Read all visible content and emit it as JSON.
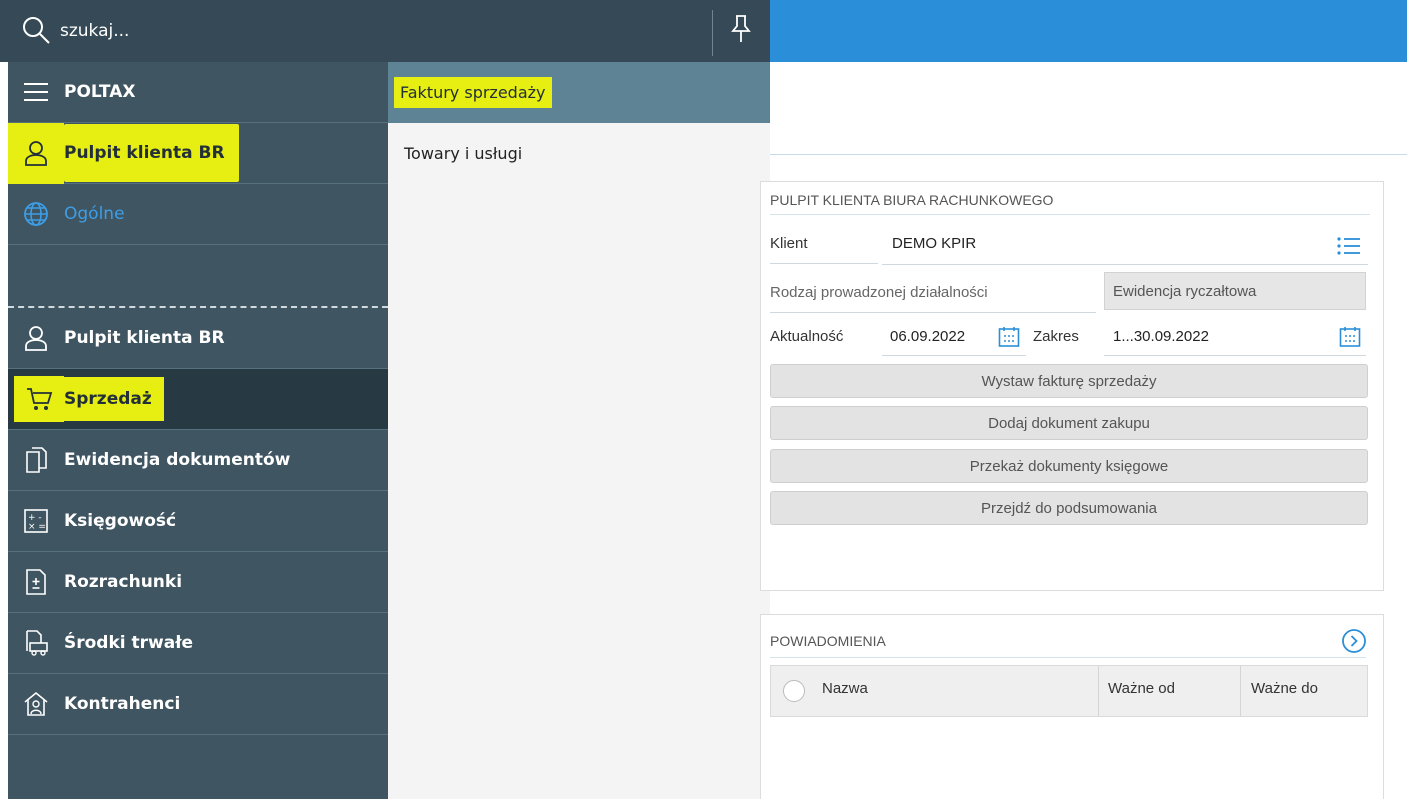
{
  "search": {
    "placeholder": "szukaj..."
  },
  "nav": {
    "items": [
      {
        "label": "POLTAX",
        "icon": "menu-icon"
      },
      {
        "label": "Pulpit klienta BR",
        "icon": "user-icon",
        "highlighted": true
      },
      {
        "label": "Ogólne",
        "icon": "globe-icon"
      },
      {
        "label": "Pulpit klienta BR",
        "icon": "user-icon"
      },
      {
        "label": "Sprzedaż",
        "icon": "cart-icon",
        "active": true,
        "highlighted": true
      },
      {
        "label": "Ewidencja dokumentów",
        "icon": "documents-icon"
      },
      {
        "label": "Księgowość",
        "icon": "calculator-icon"
      },
      {
        "label": "Rozrachunki",
        "icon": "settlement-icon"
      },
      {
        "label": "Środki trwałe",
        "icon": "assets-icon"
      },
      {
        "label": "Kontrahenci",
        "icon": "contractors-icon"
      }
    ]
  },
  "flyout": {
    "header": "Faktury sprzedaży",
    "items": [
      "Towary i usługi"
    ]
  },
  "dashboard": {
    "title": "PULPIT KLIENTA BIURA RACHUNKOWEGO",
    "client_label": "Klient",
    "client_value": "DEMO KPIR",
    "activity_label": "Rodzaj prowadzonej działalności",
    "activity_value": "Ewidencja ryczałtowa",
    "date_label": "Aktualność",
    "date_value": "06.09.2022",
    "range_label": "Zakres",
    "range_value": "1...30.09.2022",
    "buttons": [
      "Wystaw fakturę sprzedaży",
      "Dodaj dokument zakupu",
      "Przekaż dokumenty księgowe",
      "Przejdź do podsumowania"
    ]
  },
  "notifications": {
    "title": "POWIADOMIENIA",
    "columns": [
      "Nazwa",
      "Ważne od",
      "Ważne do"
    ]
  },
  "colors": {
    "topbar": "#2a8fd8",
    "nav_bg": "#3f5561",
    "highlight": "#e6ee12",
    "flyout_header": "#5e8395"
  }
}
